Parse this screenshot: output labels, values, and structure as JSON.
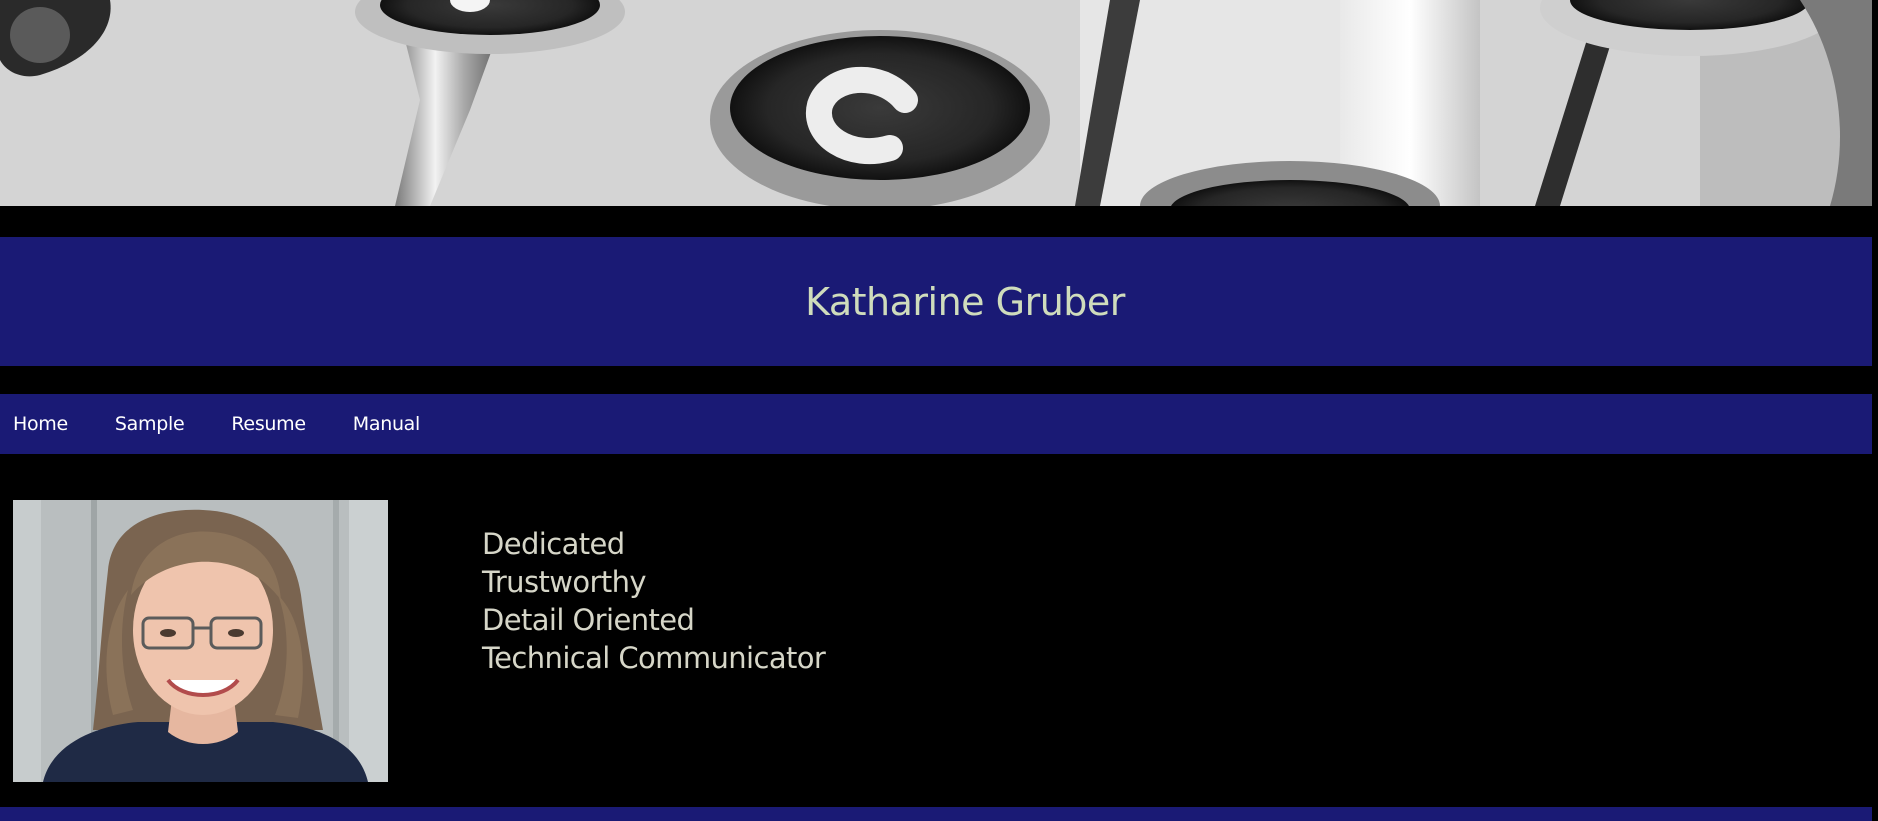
{
  "site": {
    "title": "Katharine Gruber"
  },
  "nav": {
    "items": [
      {
        "label": "Home"
      },
      {
        "label": "Sample"
      },
      {
        "label": "Resume"
      },
      {
        "label": "Manual"
      }
    ]
  },
  "profile": {
    "traits": [
      "Dedicated",
      "Trustworthy",
      "Detail Oriented",
      "Technical Communicator"
    ]
  },
  "colors": {
    "page_background": "#000000",
    "bar_background": "#1a1a75",
    "title_text": "#cfdcbc",
    "nav_text": "#ffffff",
    "trait_text": "#d6d6c8"
  },
  "images": {
    "hero": "typewriter-keys-banner",
    "portrait": "profile-portrait"
  }
}
